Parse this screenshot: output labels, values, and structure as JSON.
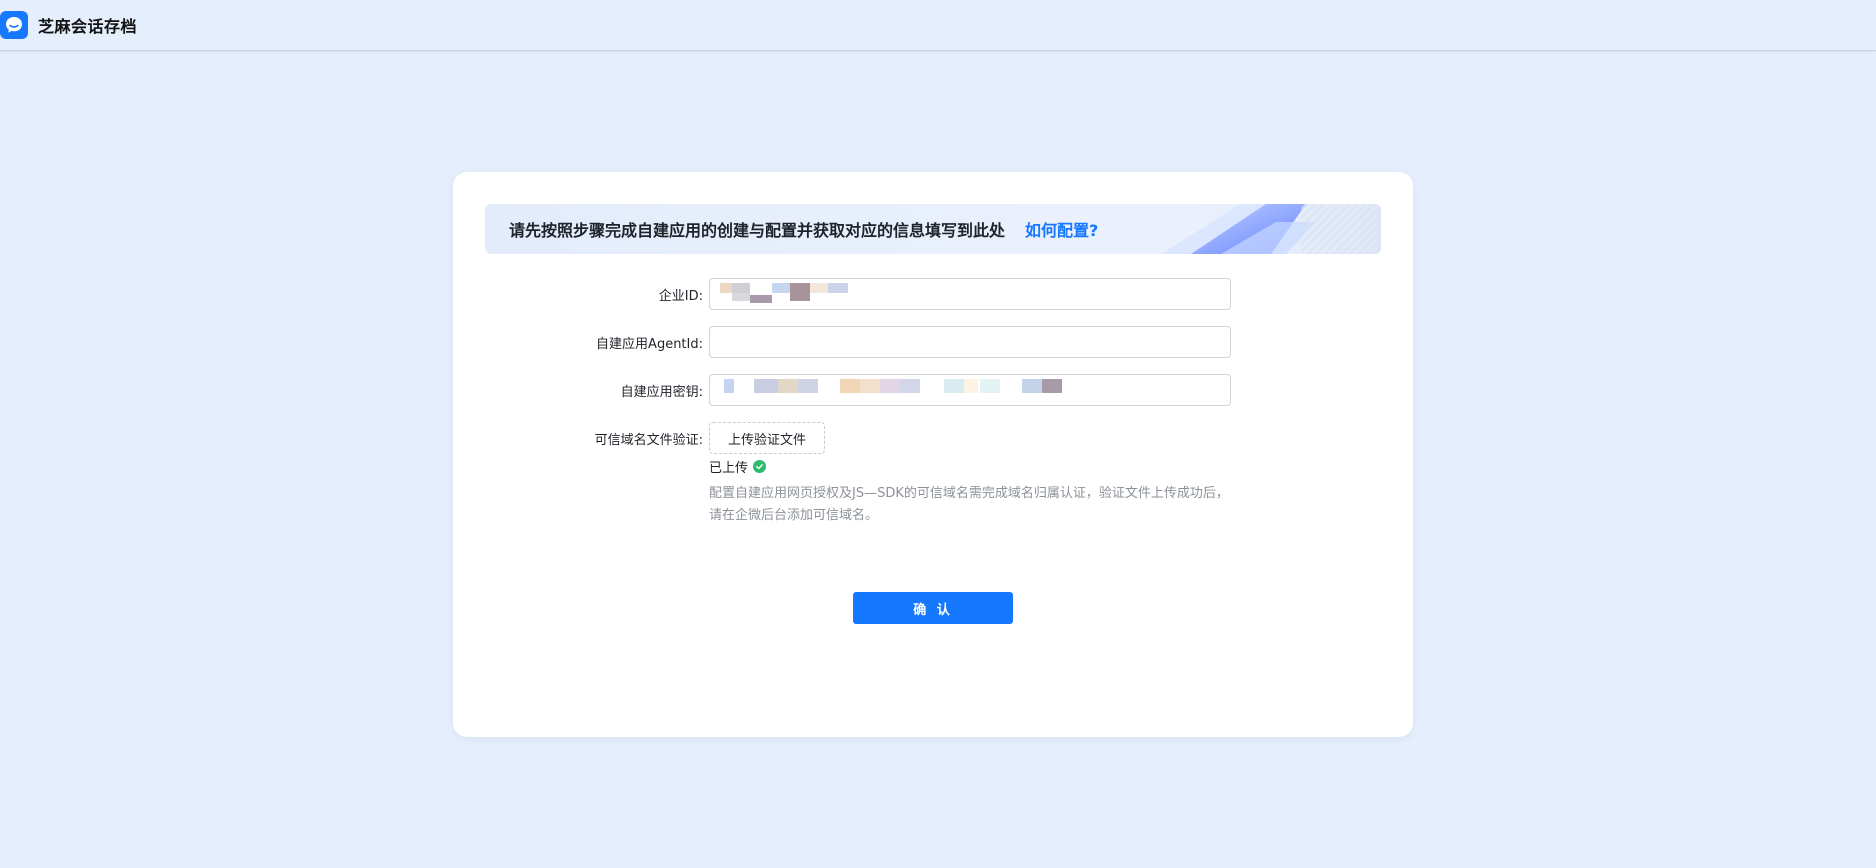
{
  "app": {
    "title": "芝麻会话存档",
    "logo_icon": "chat-bubble-icon",
    "brand_color": "#1677ff"
  },
  "banner": {
    "text": "请先按照步骤完成自建应用的创建与配置并获取对应的信息填写到此处",
    "link": "如何配置?"
  },
  "form": {
    "corp_id": {
      "label": "企业ID:",
      "value": ""
    },
    "agent_id": {
      "label": "自建应用AgentId:",
      "value": ""
    },
    "secret": {
      "label": "自建应用密钥:",
      "value": ""
    },
    "domain_verify": {
      "label": "可信域名文件验证:",
      "button": "上传验证文件",
      "status": "已上传",
      "status_icon": "check-circle-icon",
      "hint": "配置自建应用网页授权及JS—SDK的可信域名需完成域名归属认证，验证文件上传成功后，请在企微后台添加可信域名。"
    }
  },
  "confirm_label": "确 认"
}
